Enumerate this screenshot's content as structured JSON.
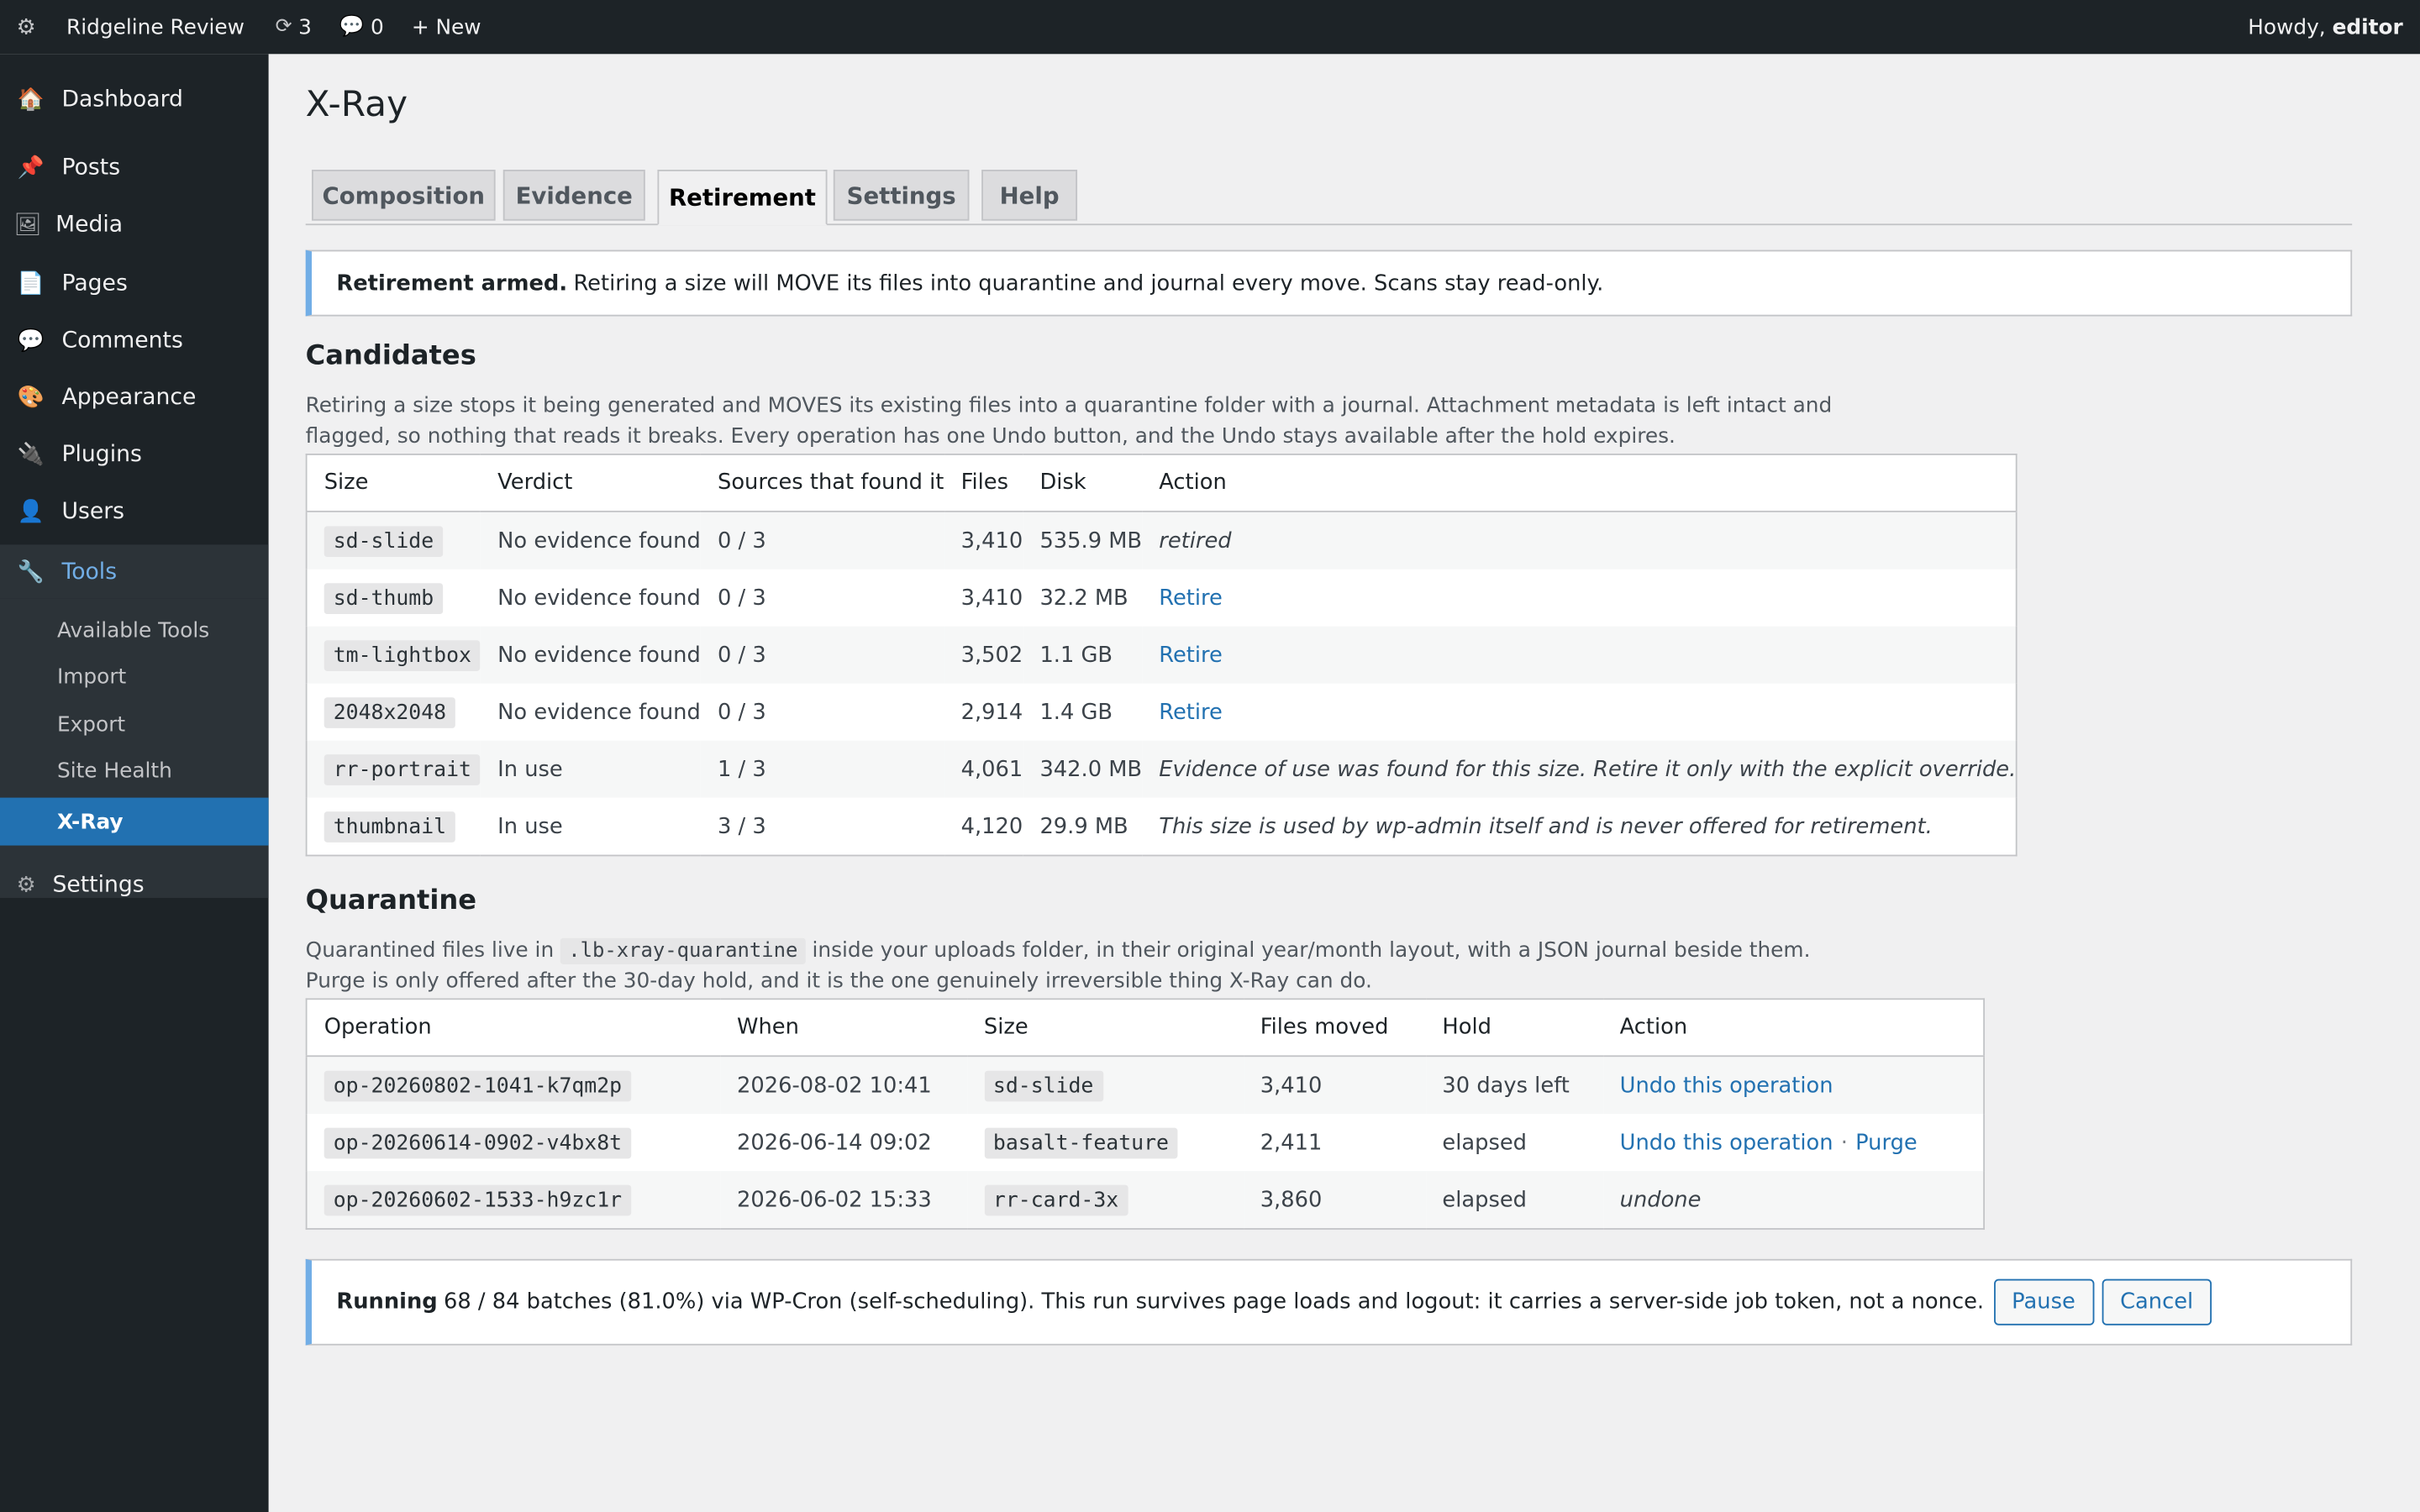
{
  "adminbar": {
    "site_name": "Ridgeline Review",
    "updates_count": "3",
    "comments_count": "0",
    "new_label": "+ New",
    "howdy_prefix": "Howdy,",
    "howdy_user": "editor"
  },
  "sidebar": {
    "items": [
      {
        "label": "Dashboard",
        "icon": "dashboard-icon"
      },
      {
        "label": "Posts",
        "icon": "pushpin-icon"
      },
      {
        "label": "Media",
        "icon": "media-icon"
      },
      {
        "label": "Pages",
        "icon": "page-icon"
      },
      {
        "label": "Comments",
        "icon": "comment-icon"
      },
      {
        "label": "Appearance",
        "icon": "paint-icon"
      },
      {
        "label": "Plugins",
        "icon": "plug-icon"
      },
      {
        "label": "Users",
        "icon": "user-icon"
      },
      {
        "label": "Tools",
        "icon": "wrench-icon"
      },
      {
        "label": "Settings",
        "icon": "gear-icon"
      }
    ],
    "tools_submenu": [
      "Available Tools",
      "Import",
      "Export",
      "Site Health",
      "X-Ray"
    ],
    "accent_color": "#2271b1"
  },
  "page": {
    "title": "X-Ray",
    "tabs": [
      "Composition",
      "Evidence",
      "Retirement",
      "Settings",
      "Help"
    ],
    "active_tab": "Retirement"
  },
  "notice_armed": {
    "bold": "Retirement armed.",
    "text": "Retiring a size will MOVE its files into quarantine and journal every move. Scans stay read-only."
  },
  "candidates": {
    "heading": "Candidates",
    "desc_line1": "Retiring a size stops it being generated and MOVES its existing files into a quarantine folder with a journal. Attachment metadata is left intact and",
    "desc_line2": "flagged, so nothing that reads it breaks. Every operation has one Undo button, and the Undo stays available after the hold expires.",
    "columns": [
      "Size",
      "Verdict",
      "Sources that found it",
      "Files",
      "Disk",
      "Action"
    ],
    "rows": [
      {
        "size": "sd-slide",
        "verdict": "No evidence found",
        "sources": "0 / 3",
        "files": "3,410",
        "disk": "535.9 MB",
        "action": "retired",
        "action_type": "note"
      },
      {
        "size": "sd-thumb",
        "verdict": "No evidence found",
        "sources": "0 / 3",
        "files": "3,410",
        "disk": "32.2 MB",
        "action": "Retire",
        "action_type": "link"
      },
      {
        "size": "tm-lightbox",
        "verdict": "No evidence found",
        "sources": "0 / 3",
        "files": "3,502",
        "disk": "1.1 GB",
        "action": "Retire",
        "action_type": "link"
      },
      {
        "size": "2048x2048",
        "verdict": "No evidence found",
        "sources": "0 / 3",
        "files": "2,914",
        "disk": "1.4 GB",
        "action": "Retire",
        "action_type": "link"
      },
      {
        "size": "rr-portrait",
        "verdict": "In use",
        "sources": "1 / 3",
        "files": "4,061",
        "disk": "342.0 MB",
        "action": "Evidence of use was found for this size. Retire it only with the explicit override.",
        "action_type": "note"
      },
      {
        "size": "thumbnail",
        "verdict": "In use",
        "sources": "3 / 3",
        "files": "4,120",
        "disk": "29.9 MB",
        "action": "This size is used by wp-admin itself and is never offered for retirement.",
        "action_type": "note"
      }
    ]
  },
  "quarantine": {
    "heading": "Quarantine",
    "desc_pre": "Quarantined files live in",
    "desc_code": ".lb-xray-quarantine",
    "desc_post": "inside your uploads folder, in their original year/month layout, with a JSON journal beside them.",
    "desc_line2": "Purge is only offered after the 30-day hold, and it is the one genuinely irreversible thing X-Ray can do.",
    "columns": [
      "Operation",
      "When",
      "Size",
      "Files moved",
      "Hold",
      "Action"
    ],
    "rows": [
      {
        "op": "op-20260802-1041-k7qm2p",
        "when": "2026-08-02 10:41",
        "size": "sd-slide",
        "files": "3,410",
        "hold": "30 days left",
        "undo": "Undo this operation",
        "purge": "",
        "note": ""
      },
      {
        "op": "op-20260614-0902-v4bx8t",
        "when": "2026-06-14 09:02",
        "size": "basalt-feature",
        "files": "2,411",
        "hold": "elapsed",
        "undo": "Undo this operation",
        "separator": "·",
        "purge": "Purge",
        "note": ""
      },
      {
        "op": "op-20260602-1533-h9zc1r",
        "when": "2026-06-02 15:33",
        "size": "rr-card-3x",
        "files": "3,860",
        "hold": "elapsed",
        "undo": "",
        "purge": "",
        "note": "undone"
      }
    ]
  },
  "running": {
    "bold": "Running",
    "text": "68 / 84 batches (81.0%) via WP-Cron (self-scheduling). This run survives page loads and logout: it carries a server-side job token, not a nonce.",
    "batches_done": 68,
    "batches_total": 84,
    "pause_label": "Pause",
    "cancel_label": "Cancel"
  }
}
